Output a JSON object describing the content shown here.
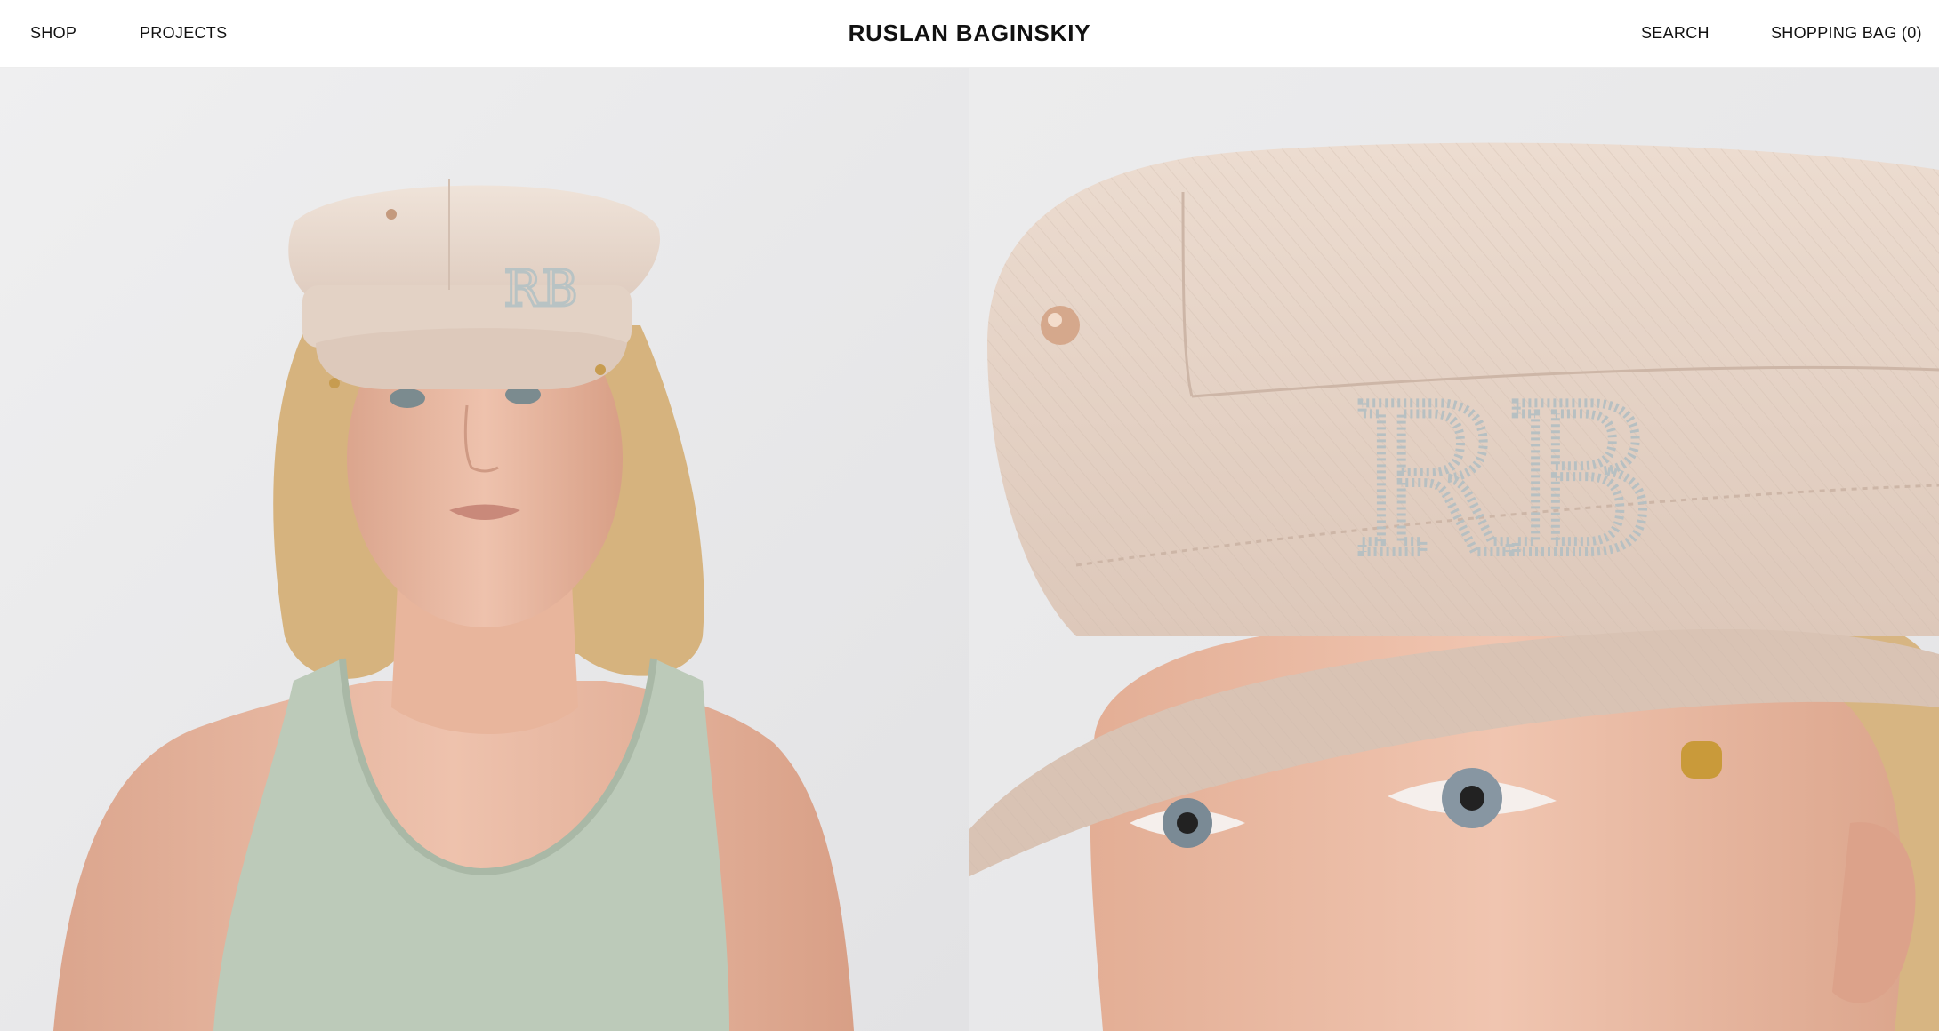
{
  "header": {
    "nav_left": [
      {
        "label": "SHOP"
      },
      {
        "label": "PROJECTS"
      }
    ],
    "brand": "RUSLAN BAGINSKIY",
    "nav_right": [
      {
        "label": "SEARCH"
      },
      {
        "label": "SHOPPING BAG (0)"
      }
    ]
  },
  "hero": {
    "left_image": {
      "subject": "model wearing beige RB cap and sage tank top"
    },
    "right_image": {
      "subject": "close-up of beige RB cap with crystal monogram"
    },
    "monogram": "RB"
  },
  "colors": {
    "background": "#e9e9ea",
    "cap": "#e7d6c9",
    "tank": "#bccab9",
    "skin": "#e6b7a0",
    "hair": "#d7b582",
    "text": "#111111"
  }
}
